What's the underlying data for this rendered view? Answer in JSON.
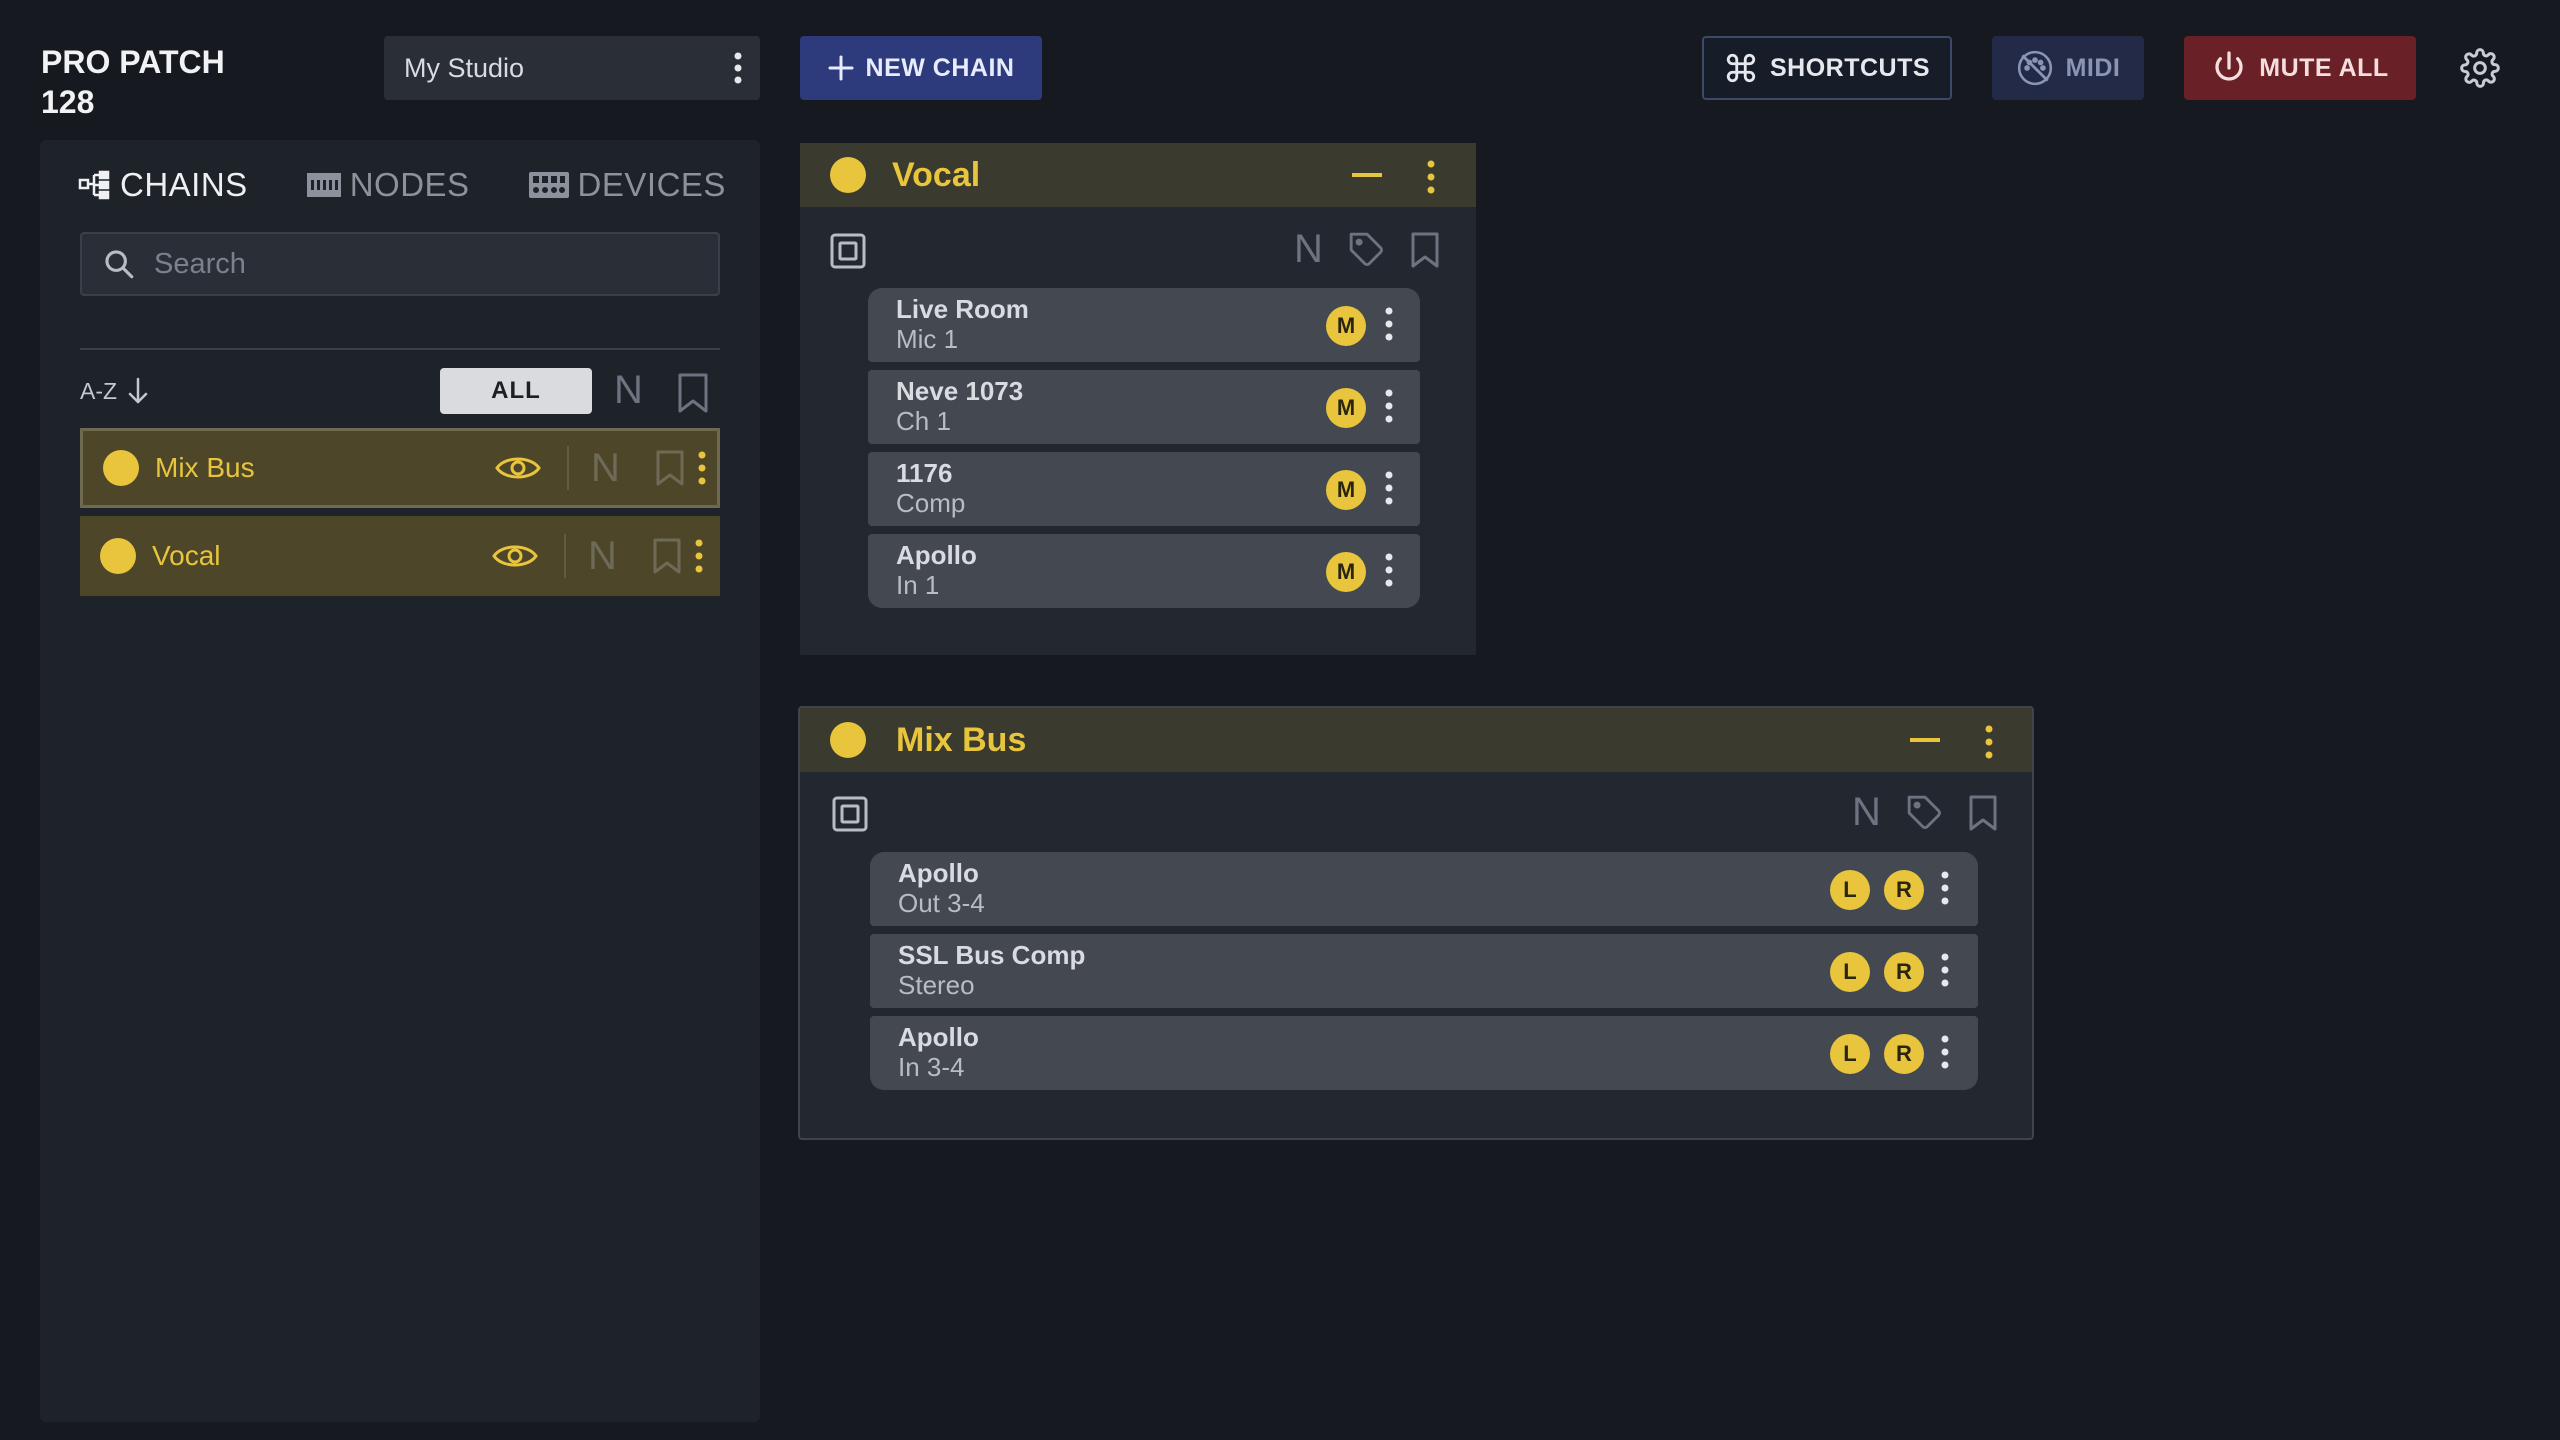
{
  "app": {
    "title": "PRO PATCH 128"
  },
  "studio": {
    "name": "My Studio"
  },
  "toolbar": {
    "new_chain": "NEW CHAIN",
    "shortcuts": "SHORTCUTS",
    "midi": "MIDI",
    "mute_all": "MUTE ALL"
  },
  "sidebar": {
    "tabs": [
      {
        "label": "CHAINS",
        "active": true
      },
      {
        "label": "NODES",
        "active": false
      },
      {
        "label": "DEVICES",
        "active": false
      }
    ],
    "search_placeholder": "Search",
    "sort_label": "A-Z",
    "filter_all": "ALL",
    "filter_n": "N",
    "chains": [
      {
        "name": "Mix Bus",
        "selected": true,
        "n": "N"
      },
      {
        "name": "Vocal",
        "selected": false,
        "n": "N"
      }
    ]
  },
  "panels": [
    {
      "title": "Vocal",
      "n": "N",
      "nodes": [
        {
          "line1": "Live Room",
          "line2": "Mic 1",
          "badges": [
            "M"
          ]
        },
        {
          "line1": "Neve 1073",
          "line2": "Ch 1",
          "badges": [
            "M"
          ]
        },
        {
          "line1": "1176",
          "line2": "Comp",
          "badges": [
            "M"
          ]
        },
        {
          "line1": "Apollo",
          "line2": "In 1",
          "badges": [
            "M"
          ]
        }
      ]
    },
    {
      "title": "Mix Bus",
      "n": "N",
      "nodes": [
        {
          "line1": "Apollo",
          "line2": "Out 3-4",
          "badges": [
            "L",
            "R"
          ]
        },
        {
          "line1": "SSL Bus Comp",
          "line2": "Stereo",
          "badges": [
            "L",
            "R"
          ]
        },
        {
          "line1": "Apollo",
          "line2": "In 3-4",
          "badges": [
            "L",
            "R"
          ]
        }
      ]
    }
  ],
  "colors": {
    "accent": "#e8c53c",
    "background": "#161a20",
    "new_chain": "#2d3a7c",
    "mute_all": "#6a2027"
  }
}
